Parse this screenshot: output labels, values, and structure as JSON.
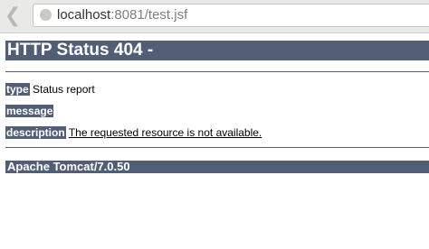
{
  "browser": {
    "url_host": "localhost",
    "url_rest": ":8081/test.jsf"
  },
  "page": {
    "heading": "HTTP Status 404 -",
    "type_label": "type",
    "type_value": "Status report",
    "message_label": "message",
    "message_value": "",
    "description_label": "description",
    "description_value": "The requested resource is not available.",
    "server_info": "Apache Tomcat/7.0.50"
  },
  "colors": {
    "header_bg": "#525d76",
    "header_text": "#ffffff"
  }
}
